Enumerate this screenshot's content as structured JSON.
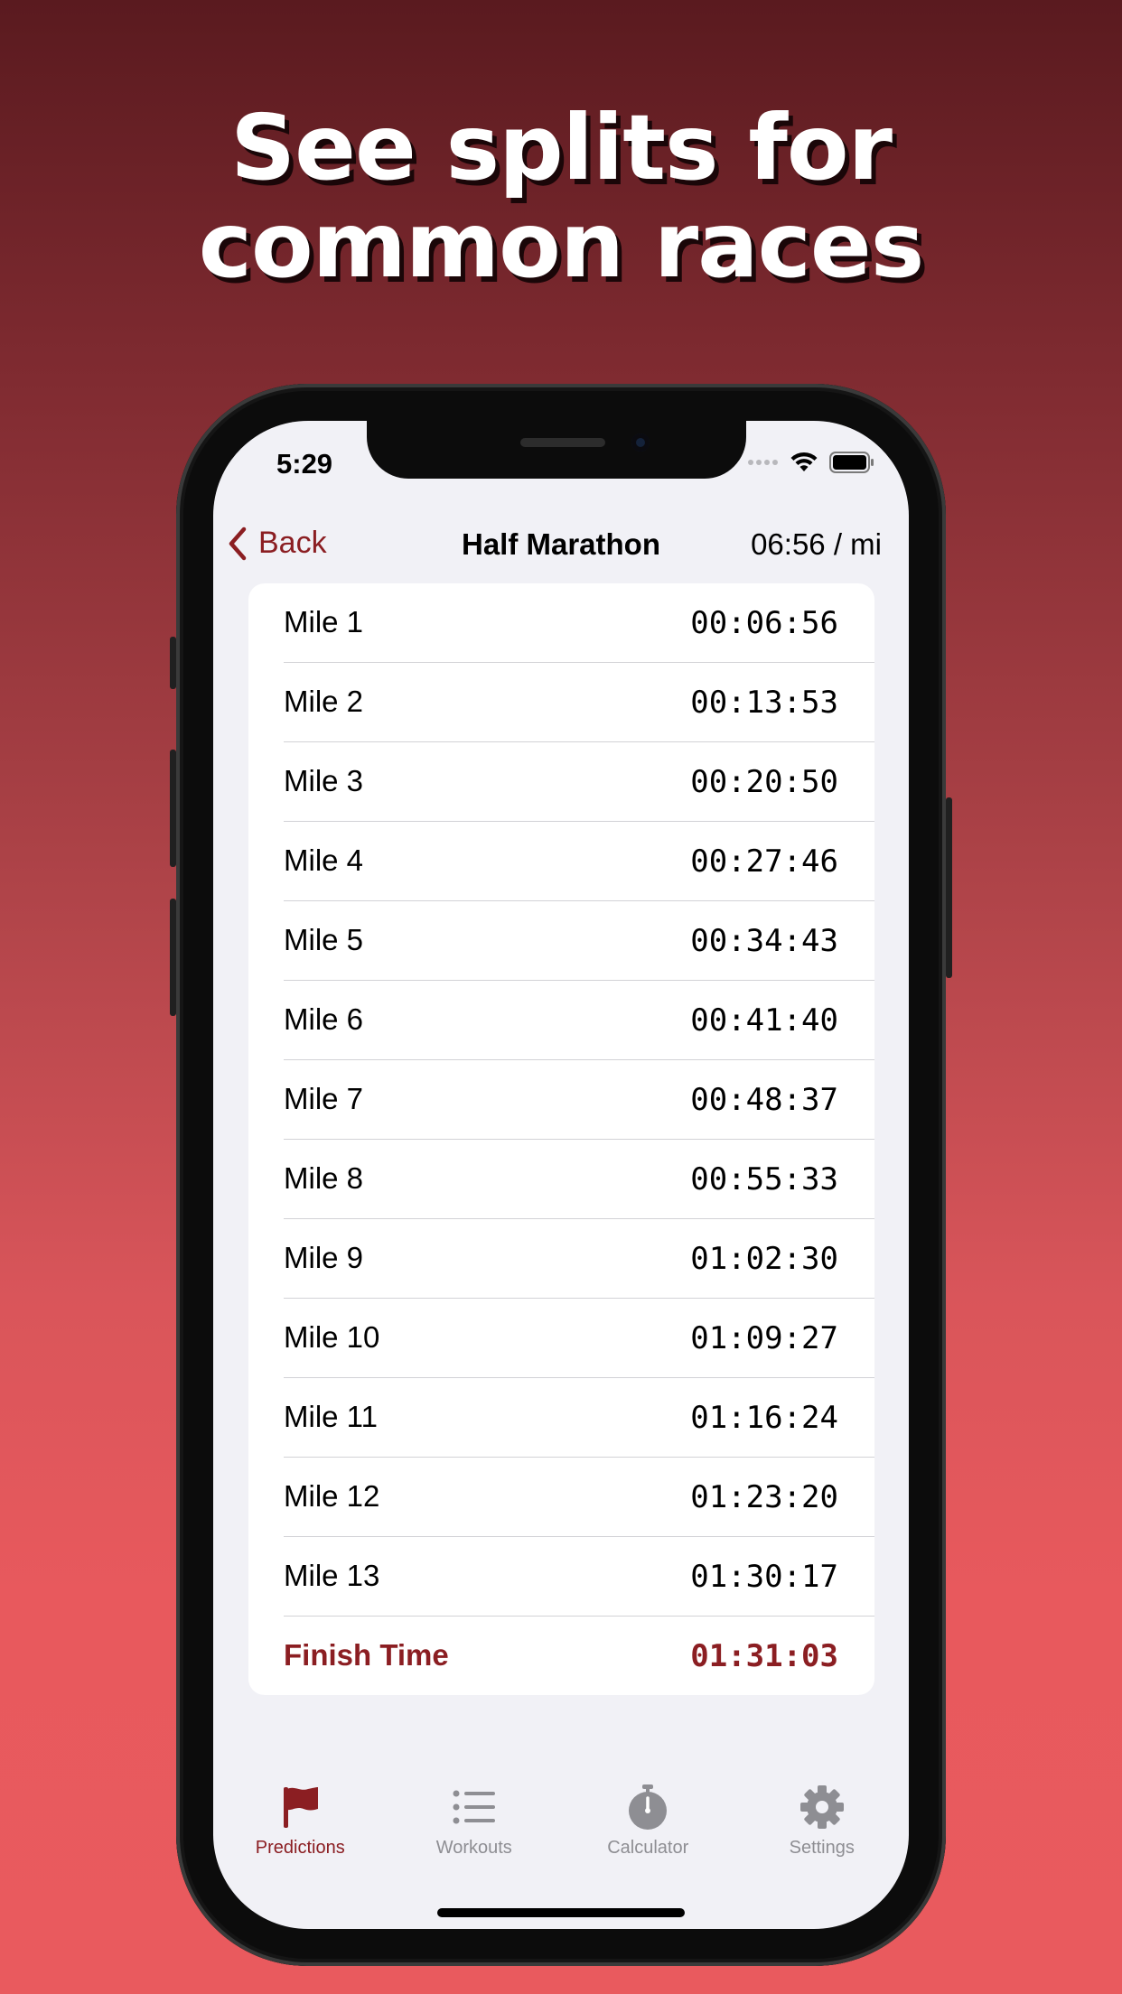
{
  "headline": {
    "line1": "See splits for",
    "line2": "common races"
  },
  "status_bar": {
    "time": "5:29"
  },
  "nav": {
    "back_label": "Back",
    "title": "Half Marathon",
    "pace": "06:56 / mi"
  },
  "splits": [
    {
      "label": "Mile 1",
      "time": "00:06:56"
    },
    {
      "label": "Mile 2",
      "time": "00:13:53"
    },
    {
      "label": "Mile 3",
      "time": "00:20:50"
    },
    {
      "label": "Mile 4",
      "time": "00:27:46"
    },
    {
      "label": "Mile 5",
      "time": "00:34:43"
    },
    {
      "label": "Mile 6",
      "time": "00:41:40"
    },
    {
      "label": "Mile 7",
      "time": "00:48:37"
    },
    {
      "label": "Mile 8",
      "time": "00:55:33"
    },
    {
      "label": "Mile 9",
      "time": "01:02:30"
    },
    {
      "label": "Mile 10",
      "time": "01:09:27"
    },
    {
      "label": "Mile 11",
      "time": "01:16:24"
    },
    {
      "label": "Mile 12",
      "time": "01:23:20"
    },
    {
      "label": "Mile 13",
      "time": "01:30:17"
    }
  ],
  "finish": {
    "label": "Finish Time",
    "time": "01:31:03"
  },
  "tabs": [
    {
      "label": "Predictions",
      "icon": "flag-icon",
      "active": true
    },
    {
      "label": "Workouts",
      "icon": "list-icon",
      "active": false
    },
    {
      "label": "Calculator",
      "icon": "stopwatch-icon",
      "active": false
    },
    {
      "label": "Settings",
      "icon": "gear-icon",
      "active": false
    }
  ],
  "colors": {
    "accent": "#8b1e22",
    "inactive": "#8e8e93",
    "background_top": "#5a1a1f",
    "background_bottom": "#e95a5e"
  }
}
